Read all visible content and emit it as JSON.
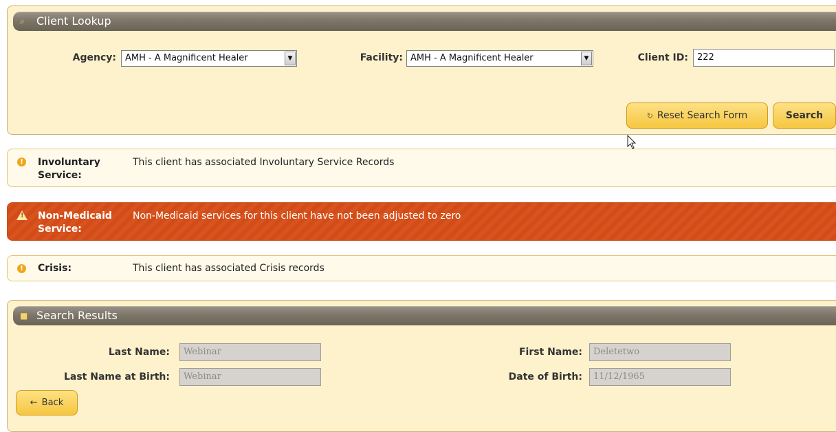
{
  "client_lookup": {
    "title": "Client Lookup",
    "agency_label": "Agency:",
    "agency_value": "AMH - A Magnificent Healer",
    "facility_label": "Facility:",
    "facility_value": "AMH - A Magnificent Healer",
    "client_id_label": "Client ID:",
    "client_id_value": "222",
    "reset_label": "Reset Search Form",
    "search_label": "Search"
  },
  "notices": [
    {
      "type": "info",
      "label_line1": "Involuntary",
      "label_line2": "Service:",
      "text": "This client has associated Involuntary Service Records"
    },
    {
      "type": "warning",
      "label_line1": "Non-Medicaid",
      "label_line2": "Service:",
      "text": "Non-Medicaid services for this client have not been adjusted to zero"
    },
    {
      "type": "info",
      "label_line1": "Crisis:",
      "text": "This client has associated Crisis records"
    }
  ],
  "search_results": {
    "title": "Search Results",
    "last_name_label": "Last Name:",
    "last_name_value": "Webinar",
    "last_name_birth_label": "Last Name at Birth:",
    "last_name_birth_value": "Webinar",
    "first_name_label": "First Name:",
    "first_name_value": "Deletetwo",
    "dob_label": "Date of Birth:",
    "dob_value": "11/12/1965",
    "back_label": "Back"
  },
  "colors": {
    "panel_bg": "#fef2cc",
    "header_bg": "#7d7669",
    "button_bg": "#f6c63f",
    "warning_bg": "#d9531e"
  }
}
